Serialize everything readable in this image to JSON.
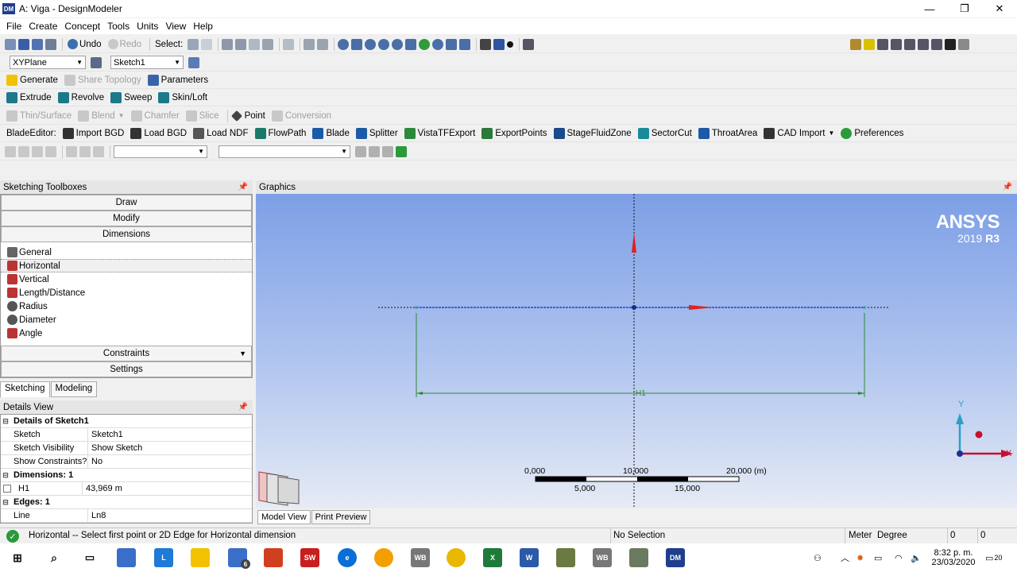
{
  "window": {
    "title": "A: Viga - DesignModeler",
    "app_badge": "DM",
    "minimize": "—",
    "maximize": "❐",
    "close": "✕"
  },
  "menu": [
    "File",
    "Create",
    "Concept",
    "Tools",
    "Units",
    "View",
    "Help"
  ],
  "toolbar1": {
    "undo": "Undo",
    "redo": "Redo",
    "select_label": "Select:"
  },
  "toolbar2": {
    "plane": "XYPlane",
    "sketch": "Sketch1"
  },
  "toolbar3": {
    "generate": "Generate",
    "share_topology": "Share Topology",
    "parameters": "Parameters"
  },
  "toolbar4": {
    "extrude": "Extrude",
    "revolve": "Revolve",
    "sweep": "Sweep",
    "skin_loft": "Skin/Loft"
  },
  "toolbar5": {
    "thin_surface": "Thin/Surface",
    "blend": "Blend",
    "chamfer": "Chamfer",
    "slice": "Slice",
    "point": "Point",
    "conversion": "Conversion"
  },
  "toolbar6": {
    "blade_editor": "BladeEditor:",
    "import_bgd": "Import BGD",
    "load_bgd": "Load BGD",
    "load_ndf": "Load NDF",
    "flowpath": "FlowPath",
    "blade": "Blade",
    "splitter": "Splitter",
    "vistatf": "VistaTFExport",
    "export_points": "ExportPoints",
    "stage_fluid": "StageFluidZone",
    "sector_cut": "SectorCut",
    "throat_area": "ThroatArea",
    "cad_import": "CAD Import",
    "preferences": "Preferences"
  },
  "sketching": {
    "header": "Sketching Toolboxes",
    "draw": "Draw",
    "modify": "Modify",
    "dimensions": "Dimensions",
    "dim_items": [
      "General",
      "Horizontal",
      "Vertical",
      "Length/Distance",
      "Radius",
      "Diameter",
      "Angle"
    ],
    "constraints": "Constraints",
    "settings": "Settings"
  },
  "tabs": {
    "sketching": "Sketching",
    "modeling": "Modeling"
  },
  "details": {
    "header": "Details View",
    "section_sketch": "Details of Sketch1",
    "rows": [
      {
        "k": "Sketch",
        "v": "Sketch1"
      },
      {
        "k": "Sketch Visibility",
        "v": "Show Sketch"
      },
      {
        "k": "Show Constraints?",
        "v": "No"
      }
    ],
    "section_dims": "Dimensions: 1",
    "dim_row": {
      "k": "H1",
      "v": "43,969 m"
    },
    "section_edges": "Edges: 1",
    "edge_row": {
      "k": "Line",
      "v": "Ln8"
    }
  },
  "graphics": {
    "header": "Graphics",
    "brand": "ANSYS",
    "version": "2019",
    "release": "R3",
    "dim_label": "H1",
    "scale": {
      "t0": "0,000",
      "t10": "10,000",
      "t20": "20,000 (m)",
      "t5": "5,000",
      "t15": "15,000"
    },
    "axis_x": "X",
    "axis_y": "Y"
  },
  "gtabs": {
    "model_view": "Model View",
    "print_preview": "Print Preview"
  },
  "status": {
    "message": "Horizontal -- Select first point or 2D Edge for Horizontal dimension",
    "selection": "No Selection",
    "units_length": "Meter",
    "units_angle": "Degree",
    "v1": "0",
    "v2": "0"
  },
  "taskbar": {
    "time": "8:32 p. m.",
    "date": "23/03/2020",
    "notif_count": "20",
    "mail_count": "6"
  }
}
